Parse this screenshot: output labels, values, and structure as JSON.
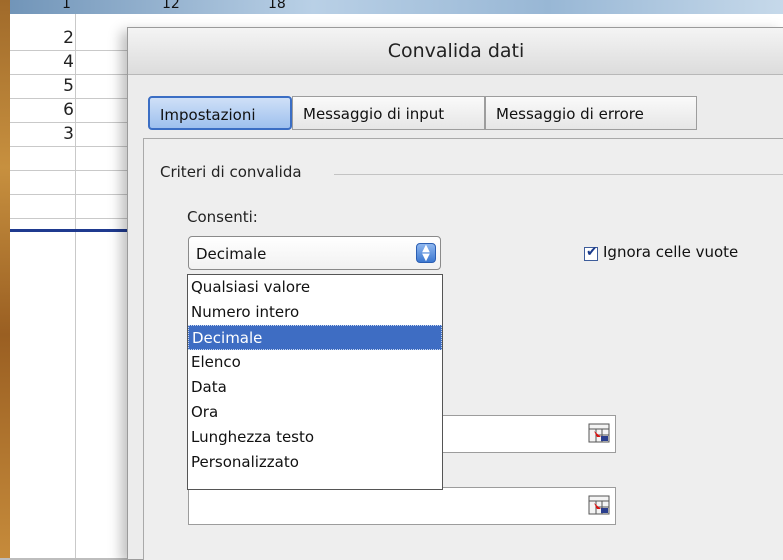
{
  "sheet": {
    "top_fragments": [
      "1",
      "12",
      "18"
    ],
    "row_values": [
      "2",
      "4",
      "5",
      "6",
      "3"
    ]
  },
  "dialog": {
    "title": "Convalida dati",
    "tabs": [
      {
        "label": "Impostazioni",
        "active": true
      },
      {
        "label": "Messaggio di input",
        "active": false
      },
      {
        "label": "Messaggio di errore",
        "active": false
      }
    ],
    "group_label": "Criteri di convalida",
    "consenti_label": "Consenti:",
    "consenti_value": "Decimale",
    "ignore_blank": {
      "label": "Ignora celle vuote",
      "checked": true
    },
    "dropdown_options": [
      "Qualsiasi valore",
      "Numero intero",
      "Decimale",
      "Elenco",
      "Data",
      "Ora",
      "Lunghezza testo",
      "Personalizzato"
    ],
    "selected_option": "Decimale"
  },
  "icons": {
    "select_arrows": "updown-arrows-icon",
    "range_picker": "range-picker-icon"
  },
  "colors": {
    "selection": "#3e6dc3",
    "active_tab": "#9ec0ee"
  }
}
